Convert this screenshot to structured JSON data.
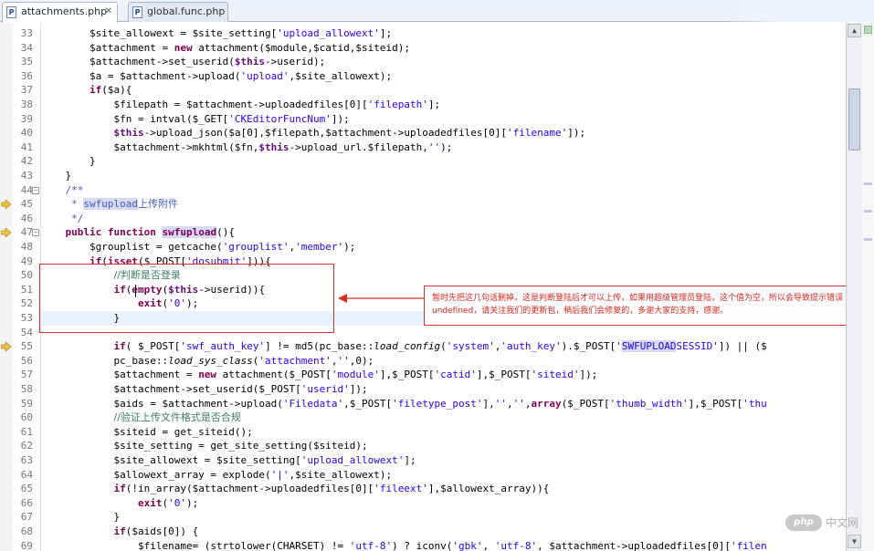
{
  "tabs": [
    {
      "label": "attachments.php",
      "icon": "php-file-icon",
      "close": "✕",
      "active": true
    },
    {
      "label": "global.func.php",
      "icon": "php-file-icon",
      "active": false
    }
  ],
  "editor": {
    "current_line": 53,
    "lines": [
      {
        "n": "33",
        "parts": [
          [
            "v",
            "        $site_allowext = $site_setting["
          ],
          [
            "s",
            "'upload_allowext'"
          ],
          [
            "v",
            "];"
          ]
        ]
      },
      {
        "n": "34",
        "parts": [
          [
            "v",
            "        $attachment = "
          ],
          [
            "k",
            "new"
          ],
          [
            "v",
            " attachment($module,$catid,$siteid);"
          ]
        ]
      },
      {
        "n": "35",
        "parts": [
          [
            "v",
            "        $attachment->set_userid("
          ],
          [
            "th",
            "$this"
          ],
          [
            "v",
            "->userid);"
          ]
        ]
      },
      {
        "n": "36",
        "parts": [
          [
            "v",
            "        $a = $attachment->upload("
          ],
          [
            "s",
            "'upload'"
          ],
          [
            "v",
            ",$site_allowext);"
          ]
        ]
      },
      {
        "n": "37",
        "parts": [
          [
            "v",
            "        "
          ],
          [
            "k",
            "if"
          ],
          [
            "v",
            "($a){"
          ]
        ]
      },
      {
        "n": "38",
        "parts": [
          [
            "v",
            "            $filepath = $attachment->uploadedfiles[0]["
          ],
          [
            "s",
            "'filepath'"
          ],
          [
            "v",
            "];"
          ]
        ]
      },
      {
        "n": "39",
        "parts": [
          [
            "v",
            "            $fn = intval($_GET["
          ],
          [
            "s",
            "'CKEditorFuncNum'"
          ],
          [
            "v",
            "]);"
          ]
        ]
      },
      {
        "n": "40",
        "parts": [
          [
            "v",
            "            "
          ],
          [
            "th",
            "$this"
          ],
          [
            "v",
            "->upload_json($a[0],$filepath,$attachment->uploadedfiles[0]["
          ],
          [
            "s",
            "'filename'"
          ],
          [
            "v",
            "]);"
          ]
        ]
      },
      {
        "n": "41",
        "parts": [
          [
            "v",
            "            $attachment->mkhtml($fn,"
          ],
          [
            "th",
            "$this"
          ],
          [
            "v",
            "->upload_url.$filepath,"
          ],
          [
            "s",
            "''"
          ],
          [
            "v",
            ");"
          ]
        ]
      },
      {
        "n": "42",
        "parts": [
          [
            "v",
            "        }"
          ]
        ]
      },
      {
        "n": "43",
        "parts": [
          [
            "v",
            "    }"
          ]
        ]
      },
      {
        "n": "44",
        "fold": "⊖",
        "parts": [
          [
            "doc",
            "    /**"
          ]
        ]
      },
      {
        "n": "45",
        "marker": "arrow",
        "parts": [
          [
            "doc",
            "     * "
          ],
          [
            "hl",
            "swfupload"
          ],
          [
            "doccn",
            "上传附件"
          ]
        ]
      },
      {
        "n": "46",
        "parts": [
          [
            "doc",
            "     */"
          ]
        ]
      },
      {
        "n": "47",
        "fold": "⊖",
        "marker": "arrow",
        "parts": [
          [
            "v",
            "    "
          ],
          [
            "k",
            "public function"
          ],
          [
            "v",
            " "
          ],
          [
            "hlb",
            "swfupload"
          ],
          [
            "v",
            "(){"
          ]
        ]
      },
      {
        "n": "48",
        "parts": [
          [
            "v",
            "        $grouplist = getcache("
          ],
          [
            "s",
            "'grouplist'"
          ],
          [
            "v",
            ","
          ],
          [
            "s",
            "'member'"
          ],
          [
            "v",
            ");"
          ]
        ]
      },
      {
        "n": "49",
        "parts": [
          [
            "v",
            "        "
          ],
          [
            "k",
            "if"
          ],
          [
            "v",
            "("
          ],
          [
            "k",
            "isset"
          ],
          [
            "v",
            "($_POST["
          ],
          [
            "s",
            "'dosubmit'"
          ],
          [
            "v",
            "])){"
          ]
        ]
      },
      {
        "n": "50",
        "parts": [
          [
            "v",
            "            "
          ],
          [
            "ccn",
            "//判断是否登录"
          ]
        ]
      },
      {
        "n": "51",
        "parts": [
          [
            "v",
            "            "
          ],
          [
            "k",
            "if"
          ],
          [
            "v",
            "("
          ],
          [
            "k",
            "empty"
          ],
          [
            "v",
            "("
          ],
          [
            "th",
            "$this"
          ],
          [
            "v",
            "->userid)){"
          ]
        ]
      },
      {
        "n": "52",
        "parts": [
          [
            "v",
            "                "
          ],
          [
            "k",
            "exit"
          ],
          [
            "v",
            "("
          ],
          [
            "s",
            "'0'"
          ],
          [
            "v",
            ");"
          ]
        ]
      },
      {
        "n": "53",
        "parts": [
          [
            "v",
            "            }"
          ]
        ]
      },
      {
        "n": "54",
        "parts": [
          [
            "v",
            ""
          ]
        ]
      },
      {
        "n": "55",
        "marker": "arrow",
        "parts": [
          [
            "v",
            "            "
          ],
          [
            "k",
            "if"
          ],
          [
            "v",
            "( $_POST["
          ],
          [
            "s",
            "'swf_auth_key'"
          ],
          [
            "v",
            "] != md5(pc_base::"
          ],
          [
            "it",
            "load_config"
          ],
          [
            "v",
            "("
          ],
          [
            "s",
            "'system'"
          ],
          [
            "v",
            ","
          ],
          [
            "s",
            "'auth_key'"
          ],
          [
            "v",
            ").$_POST["
          ],
          [
            "s",
            "'"
          ],
          [
            "hls",
            "SWFUPLOAD"
          ],
          [
            "s",
            "SESSID'"
          ],
          [
            "v",
            "]) || ($"
          ]
        ]
      },
      {
        "n": "56",
        "parts": [
          [
            "v",
            "            pc_base::"
          ],
          [
            "it",
            "load_sys_class"
          ],
          [
            "v",
            "("
          ],
          [
            "s",
            "'attachment'"
          ],
          [
            "v",
            ","
          ],
          [
            "s",
            "''"
          ],
          [
            "v",
            ",0);"
          ]
        ]
      },
      {
        "n": "57",
        "parts": [
          [
            "v",
            "            $attachment = "
          ],
          [
            "k",
            "new"
          ],
          [
            "v",
            " attachment($_POST["
          ],
          [
            "s",
            "'module'"
          ],
          [
            "v",
            "],$_POST["
          ],
          [
            "s",
            "'catid'"
          ],
          [
            "v",
            "],$_POST["
          ],
          [
            "s",
            "'siteid'"
          ],
          [
            "v",
            "]);"
          ]
        ]
      },
      {
        "n": "58",
        "parts": [
          [
            "v",
            "            $attachment->set_userid($_POST["
          ],
          [
            "s",
            "'userid'"
          ],
          [
            "v",
            "]);"
          ]
        ]
      },
      {
        "n": "59",
        "parts": [
          [
            "v",
            "            $aids = $attachment->upload("
          ],
          [
            "s",
            "'Filedata'"
          ],
          [
            "v",
            ",$_POST["
          ],
          [
            "s",
            "'filetype_post'"
          ],
          [
            "v",
            "],"
          ],
          [
            "s",
            "''"
          ],
          [
            "v",
            ","
          ],
          [
            "s",
            "''"
          ],
          [
            "v",
            ","
          ],
          [
            "k",
            "array"
          ],
          [
            "v",
            "($_POST["
          ],
          [
            "s",
            "'thumb_width'"
          ],
          [
            "v",
            "],$_POST["
          ],
          [
            "s",
            "'thu"
          ]
        ]
      },
      {
        "n": "60",
        "parts": [
          [
            "v",
            "            "
          ],
          [
            "ccn",
            "//验证上传文件格式是否合规"
          ]
        ]
      },
      {
        "n": "61",
        "parts": [
          [
            "v",
            "            $siteid = get_siteid();"
          ]
        ]
      },
      {
        "n": "62",
        "parts": [
          [
            "v",
            "            $site_setting = get_site_setting($siteid);"
          ]
        ]
      },
      {
        "n": "63",
        "parts": [
          [
            "v",
            "            $site_allowext = $site_setting["
          ],
          [
            "s",
            "'upload_allowext'"
          ],
          [
            "v",
            "];"
          ]
        ]
      },
      {
        "n": "64",
        "parts": [
          [
            "v",
            "            $allowext_array = explode("
          ],
          [
            "s",
            "'|'"
          ],
          [
            "v",
            ",$site_allowext);"
          ]
        ]
      },
      {
        "n": "65",
        "parts": [
          [
            "v",
            "            "
          ],
          [
            "k",
            "if"
          ],
          [
            "v",
            "(!in_array($attachment->uploadedfiles[0]["
          ],
          [
            "s",
            "'fileext'"
          ],
          [
            "v",
            "],$allowext_array)){"
          ]
        ]
      },
      {
        "n": "66",
        "parts": [
          [
            "v",
            "                "
          ],
          [
            "k",
            "exit"
          ],
          [
            "v",
            "("
          ],
          [
            "s",
            "'0'"
          ],
          [
            "v",
            ");"
          ]
        ]
      },
      {
        "n": "67",
        "parts": [
          [
            "v",
            "            }"
          ]
        ]
      },
      {
        "n": "68",
        "parts": [
          [
            "v",
            "            "
          ],
          [
            "k",
            "if"
          ],
          [
            "v",
            "($aids[0]) {"
          ]
        ]
      },
      {
        "n": "69",
        "parts": [
          [
            "v",
            "                $filename= (strtolower(CHARSET) != "
          ],
          [
            "s",
            "'utf-8'"
          ],
          [
            "v",
            ") ? iconv("
          ],
          [
            "s",
            "'gbk'"
          ],
          [
            "v",
            ", "
          ],
          [
            "s",
            "'utf-8'"
          ],
          [
            "v",
            ", $attachment->uploadedfiles[0]["
          ],
          [
            "s",
            "'filen"
          ]
        ]
      }
    ]
  },
  "annotation": {
    "note": "暂时先把这几句话删掉，这是判断登陆后才可以上传，如果用超级管理员登陆，这个值为空，所以会导致提示错误undefined，请关注我们的更新包，稍后我们会修复的，多谢大家的支持，感谢。"
  },
  "scrollbar": {
    "up": "▲",
    "down": "▼"
  },
  "watermark": {
    "badge": "php",
    "text": "中文网"
  },
  "colors": {
    "keyword": "#7f0055",
    "string": "#2a00ff",
    "comment": "#3f7f5f",
    "doc": "#3f5fbf",
    "annotation": "#d52a22"
  }
}
